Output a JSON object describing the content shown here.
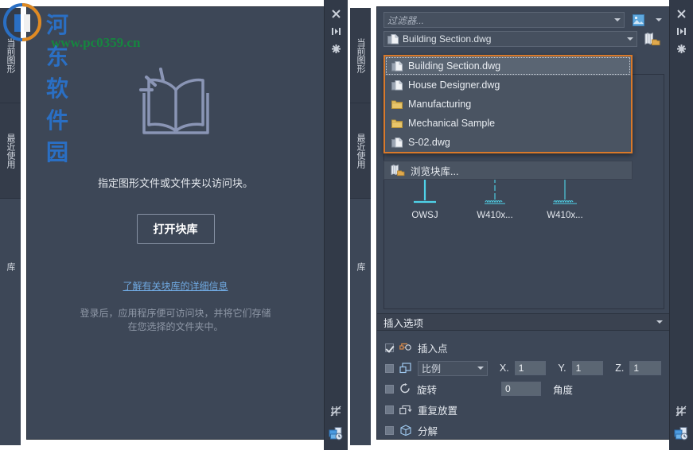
{
  "colors": {
    "panel_bg": "#3d4757",
    "tab_bg": "#343c4a",
    "accent_orange": "#d9792a",
    "link_blue": "#6fa8e0",
    "block_cyan": "#4fd2e8",
    "folder_yellow": "#e8c56a"
  },
  "watermark": {
    "title": "河东软件园",
    "url": "www.pc0359.cn"
  },
  "left_panel": {
    "tabs": [
      {
        "label": "当前图形",
        "name": "tab-current-drawing"
      },
      {
        "label": "最近使用",
        "name": "tab-recently-used"
      },
      {
        "label": "库",
        "name": "tab-library"
      }
    ],
    "rail": [
      {
        "icon": "close-icon",
        "glyph": "✕"
      },
      {
        "icon": "dock-pin-icon",
        "glyph": "▸|"
      },
      {
        "icon": "settings-star-icon",
        "glyph": "✺"
      }
    ],
    "rail_bottom": [
      {
        "icon": "block-symbol-icon"
      },
      {
        "icon": "insert-block-icon"
      }
    ],
    "empty_state": {
      "icon": "open-book-icon",
      "message": "指定图形文件或文件夹以访问块。",
      "button_label": "打开块库",
      "link_label": "了解有关块库的详细信息",
      "note_line1": "登录后，应用程序便可访问块，并将它们存储",
      "note_line2": "在您选择的文件夹中。"
    }
  },
  "right_panel": {
    "tabs": [
      {
        "label": "当前图形",
        "name": "tab-current-drawing"
      },
      {
        "label": "最近使用",
        "name": "tab-recently-used"
      },
      {
        "label": "库",
        "name": "tab-library"
      }
    ],
    "rail": [
      {
        "icon": "close-icon",
        "glyph": "✕"
      },
      {
        "icon": "dock-pin-icon",
        "glyph": "▸|"
      },
      {
        "icon": "settings-star-icon",
        "glyph": "✺"
      }
    ],
    "filter": {
      "placeholder": "过滤器...",
      "value": "",
      "view_icon": "thumbnail-view-icon",
      "view_caret_icon": "chevron-down-icon"
    },
    "library_combo": {
      "value": "Building Section.dwg",
      "icon": "dwg-file-icon",
      "browse_icon": "browse-block-library-icon"
    },
    "dropdown": {
      "open": true,
      "items": [
        {
          "label": "Building Section.dwg",
          "icon": "dwg-file-icon",
          "selected": true
        },
        {
          "label": "House Designer.dwg",
          "icon": "dwg-file-icon",
          "selected": false
        },
        {
          "label": "Manufacturing",
          "icon": "folder-icon",
          "selected": false
        },
        {
          "label": "Mechanical Sample",
          "icon": "folder-icon",
          "selected": false
        },
        {
          "label": "S-02.dwg",
          "icon": "dwg-file-icon",
          "selected": false
        }
      ],
      "browse_label": "浏览块库...",
      "browse_icon": "browse-block-library-icon"
    },
    "blocks": [
      {
        "name": "OWSJ",
        "thumb": "joist-symbol"
      },
      {
        "name": "W410x...",
        "thumb": "beam-symbol-a"
      },
      {
        "name": "W410x...",
        "thumb": "beam-symbol-b"
      }
    ],
    "insert_options": {
      "title": "插入选项",
      "collapse_icon": "chevron-down-icon",
      "rows": {
        "insertion_point": {
          "label": "插入点",
          "checked": true,
          "icon": "insertion-point-icon"
        },
        "scale": {
          "label": "比例",
          "checked": false,
          "icon": "scale-icon",
          "x": {
            "label": "X.",
            "value": "1"
          },
          "y": {
            "label": "Y.",
            "value": "1"
          },
          "z": {
            "label": "Z.",
            "value": "1"
          }
        },
        "rotation": {
          "label": "旋转",
          "checked": false,
          "icon": "rotation-icon",
          "value": "0",
          "unit": "角度"
        },
        "repeat": {
          "label": "重复放置",
          "checked": false,
          "icon": "repeat-place-icon"
        },
        "explode": {
          "label": "分解",
          "checked": false,
          "icon": "explode-icon"
        }
      }
    },
    "rail_bottom": [
      {
        "icon": "block-symbol-icon"
      },
      {
        "icon": "insert-block-icon"
      }
    ]
  }
}
